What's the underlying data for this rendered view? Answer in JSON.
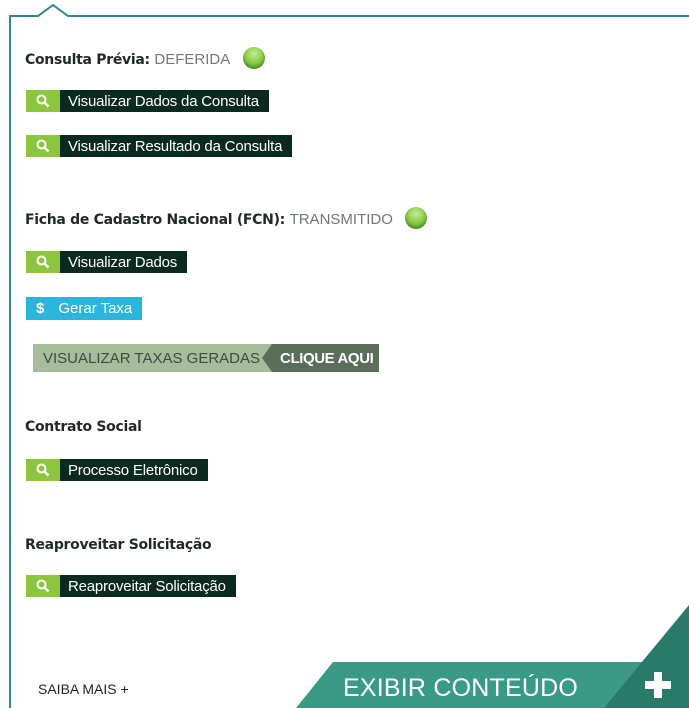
{
  "colors": {
    "border": "#2f8a82",
    "button_dark": "#0b2a1f",
    "icon_green": "#8cc63f",
    "tax_blue": "#2bb5dd",
    "corner_teal": "#2d8776"
  },
  "consulta": {
    "label": "Consulta Prévia:",
    "status": "DEFERIDA",
    "buttons": [
      {
        "icon": "search-icon",
        "label": "Visualizar Dados da Consulta"
      },
      {
        "icon": "search-icon",
        "label": "Visualizar Resultado da Consulta"
      }
    ]
  },
  "fcn": {
    "label": "Ficha de Cadastro Nacional (FCN):",
    "status": "TRANSMITIDO",
    "view_button": {
      "icon": "search-icon",
      "label": "Visualizar Dados"
    },
    "tax_button": {
      "icon": "$",
      "label": "Gerar Taxa"
    },
    "view_taxes": {
      "left": "VISUALIZAR TAXAS GERADAS",
      "right": "CLIQUE AQUI"
    }
  },
  "contrato": {
    "label": "Contrato Social",
    "button": {
      "icon": "search-icon",
      "label": "Processo Eletrônico"
    }
  },
  "reaproveitar": {
    "label": "Reaproveitar Solicitação",
    "button": {
      "icon": "search-icon",
      "label": "Reaproveitar Solicitação"
    }
  },
  "footer": {
    "saiba_mais": "SAIBA MAIS +",
    "exibir": "EXIBIR CONTEÚDO",
    "plus_icon": "plus-icon"
  }
}
